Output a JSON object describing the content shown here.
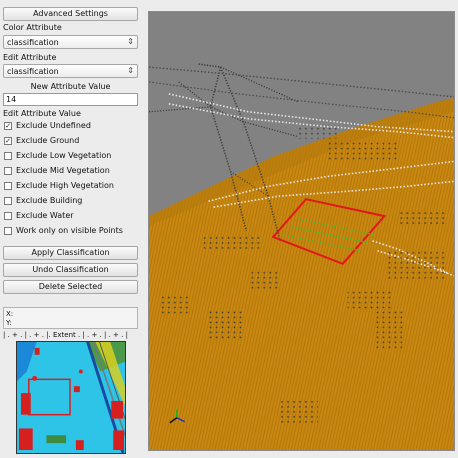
{
  "sidebar": {
    "advanced_settings": "Advanced Settings",
    "color_attribute_label": "Color Attribute",
    "color_attribute_value": "classification",
    "edit_attribute_label": "Edit Attribute",
    "edit_attribute_value": "classification",
    "new_attribute_value_label": "New Attribute Value",
    "new_attribute_value": "14",
    "edit_attribute_value_label": "Edit Attribute Value",
    "checkboxes": [
      {
        "label": "Exclude Undefined",
        "checked": true
      },
      {
        "label": "Exclude Ground",
        "checked": true
      },
      {
        "label": "Exclude Low Vegetation",
        "checked": false
      },
      {
        "label": "Exclude Mid Vegetation",
        "checked": false
      },
      {
        "label": "Exclude High Vegetation",
        "checked": false
      },
      {
        "label": "Exclude Building",
        "checked": false
      },
      {
        "label": "Exclude Water",
        "checked": false
      },
      {
        "label": "Work only on visible Points",
        "checked": false
      }
    ],
    "apply_classification": "Apply Classification",
    "undo_classification": "Undo Classification",
    "delete_selected": "Delete Selected",
    "coord_x": "X:",
    "coord_y": "Y:",
    "extent_ruler": "| . + . | . + . |. Extent . | . + . | . + . |",
    "check_mark": "✓"
  },
  "colors": {
    "ground": "#c8870f",
    "points_dark": "#3e3e3e",
    "selection_box": "#e01818",
    "selected_points": "#38c038",
    "sky": "#828282"
  }
}
